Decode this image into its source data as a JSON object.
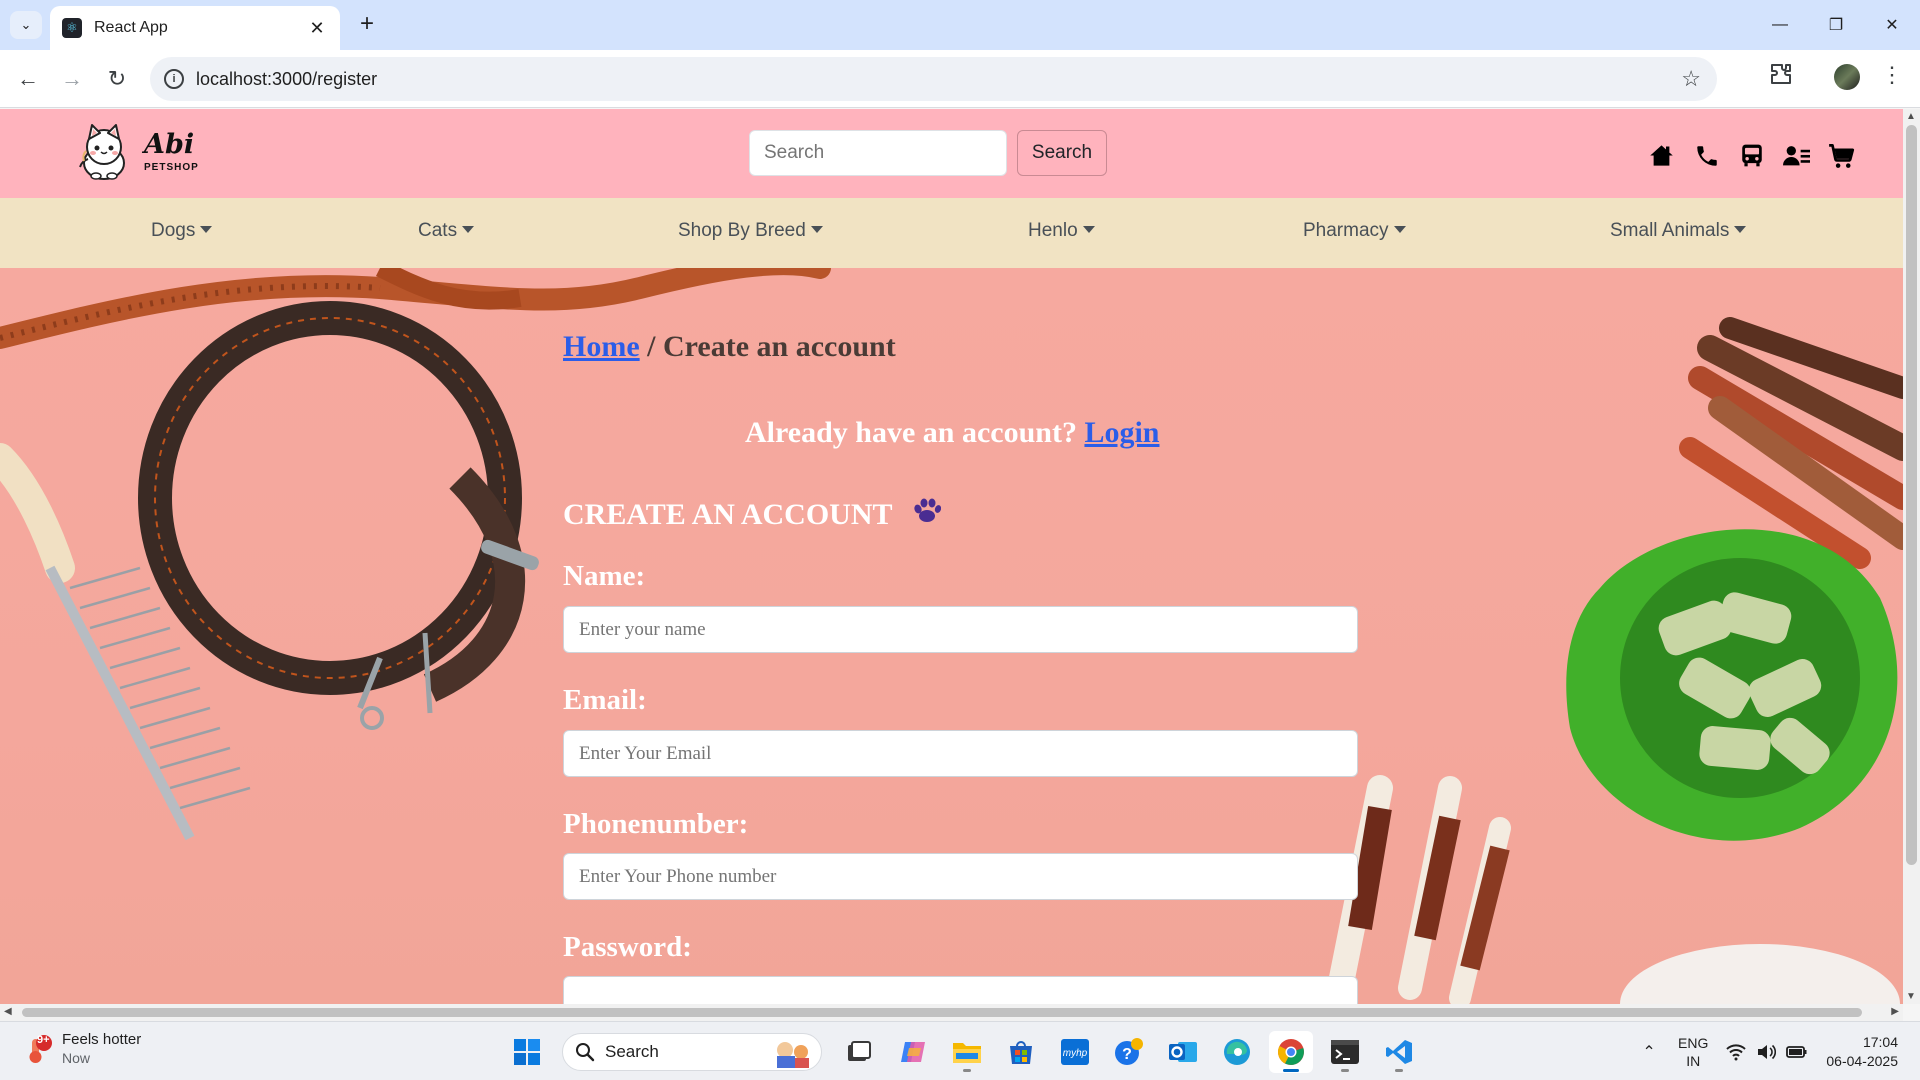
{
  "browser": {
    "tab_title": "React App",
    "url": "localhost:3000/register"
  },
  "site": {
    "logo_text": "Abi",
    "logo_subtext": "PETSHOP",
    "search_placeholder": "Search",
    "search_button": "Search",
    "header_icons": [
      "home-icon",
      "phone-icon",
      "bus-icon",
      "user-card-icon",
      "cart-icon"
    ],
    "nav": [
      {
        "label": "Dogs"
      },
      {
        "label": "Cats"
      },
      {
        "label": "Shop By Breed"
      },
      {
        "label": "Henlo"
      },
      {
        "label": "Pharmacy"
      },
      {
        "label": "Small Animals"
      }
    ],
    "breadcrumb": {
      "home": "Home",
      "separator": " / ",
      "current": "Create an account"
    },
    "already": {
      "text": "Already have an account? ",
      "link": "Login"
    },
    "form": {
      "title": "CREATE AN ACCOUNT",
      "fields": [
        {
          "label": "Name:",
          "placeholder": "Enter your name"
        },
        {
          "label": "Email:",
          "placeholder": "Enter Your Email"
        },
        {
          "label": "Phonenumber:",
          "placeholder": "Enter Your Phone number"
        },
        {
          "label": "Password:",
          "placeholder": ""
        }
      ]
    },
    "colors": {
      "header": "#ffb3bd",
      "nav": "#f1e3c3",
      "hero": "#f6a99f",
      "link": "#2b5de8"
    }
  },
  "taskbar": {
    "weather": {
      "badge": "9+",
      "title": "Feels hotter",
      "subtitle": "Now"
    },
    "search_label": "Search",
    "apps": [
      "windows-start",
      "search",
      "task-view",
      "copilot",
      "file-explorer",
      "microsoft-store",
      "myhp",
      "help",
      "outlook",
      "edge",
      "chrome",
      "terminal",
      "vscode"
    ],
    "lang": {
      "line1": "ENG",
      "line2": "IN"
    },
    "clock": {
      "time": "17:04",
      "date": "06-04-2025"
    }
  }
}
